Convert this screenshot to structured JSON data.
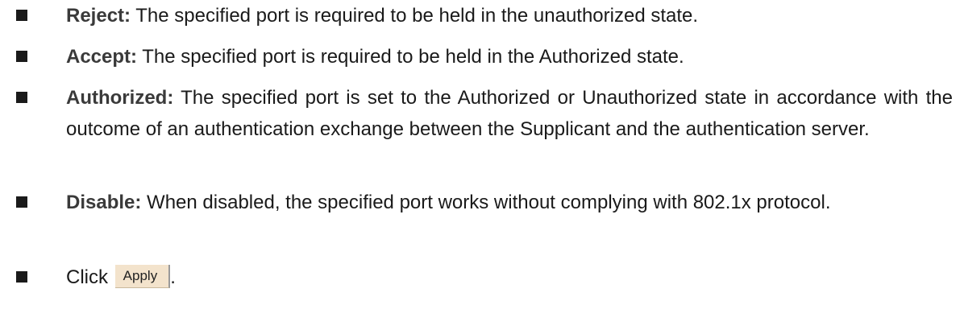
{
  "items": [
    {
      "term": "Reject:",
      "text": "The specified port is required to be held in the unauthorized state."
    },
    {
      "term": "Accept:",
      "text": "The specified port is required to be held in the Authorized state."
    },
    {
      "term": "Authorized:",
      "text": "The specified port is set to the Authorized or Unauthorized state in accordance with the outcome of an authentication exchange between the Supplicant and the authentication server."
    },
    {
      "term": "Disable:",
      "text": "When disabled, the specified port works without complying with 802.1x protocol."
    }
  ],
  "final_step": {
    "prefix": "Click",
    "button_label": "Apply",
    "suffix": "."
  }
}
